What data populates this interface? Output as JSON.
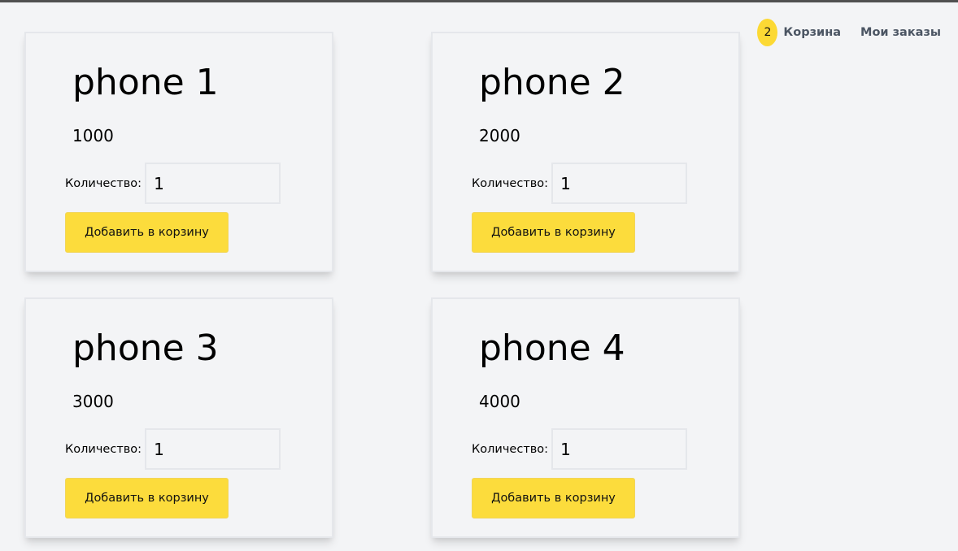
{
  "header": {
    "cart_count": "2",
    "cart_label": "Корзина",
    "orders_label": "Мои заказы"
  },
  "products": [
    {
      "name": "phone 1",
      "price": "1000",
      "qty_label": "Количество:",
      "qty_value": "1",
      "add_label": "Добавить в корзину"
    },
    {
      "name": "phone 2",
      "price": "2000",
      "qty_label": "Количество:",
      "qty_value": "1",
      "add_label": "Добавить в корзину"
    },
    {
      "name": "phone 3",
      "price": "3000",
      "qty_label": "Количество:",
      "qty_value": "1",
      "add_label": "Добавить в корзину"
    },
    {
      "name": "phone 4",
      "price": "4000",
      "qty_label": "Количество:",
      "qty_value": "1",
      "add_label": "Добавить в корзину"
    }
  ],
  "colors": {
    "accent": "#fcdc3c",
    "background": "#f3f4f6",
    "border": "#e5e7eb",
    "nav_text": "#4b5563"
  }
}
